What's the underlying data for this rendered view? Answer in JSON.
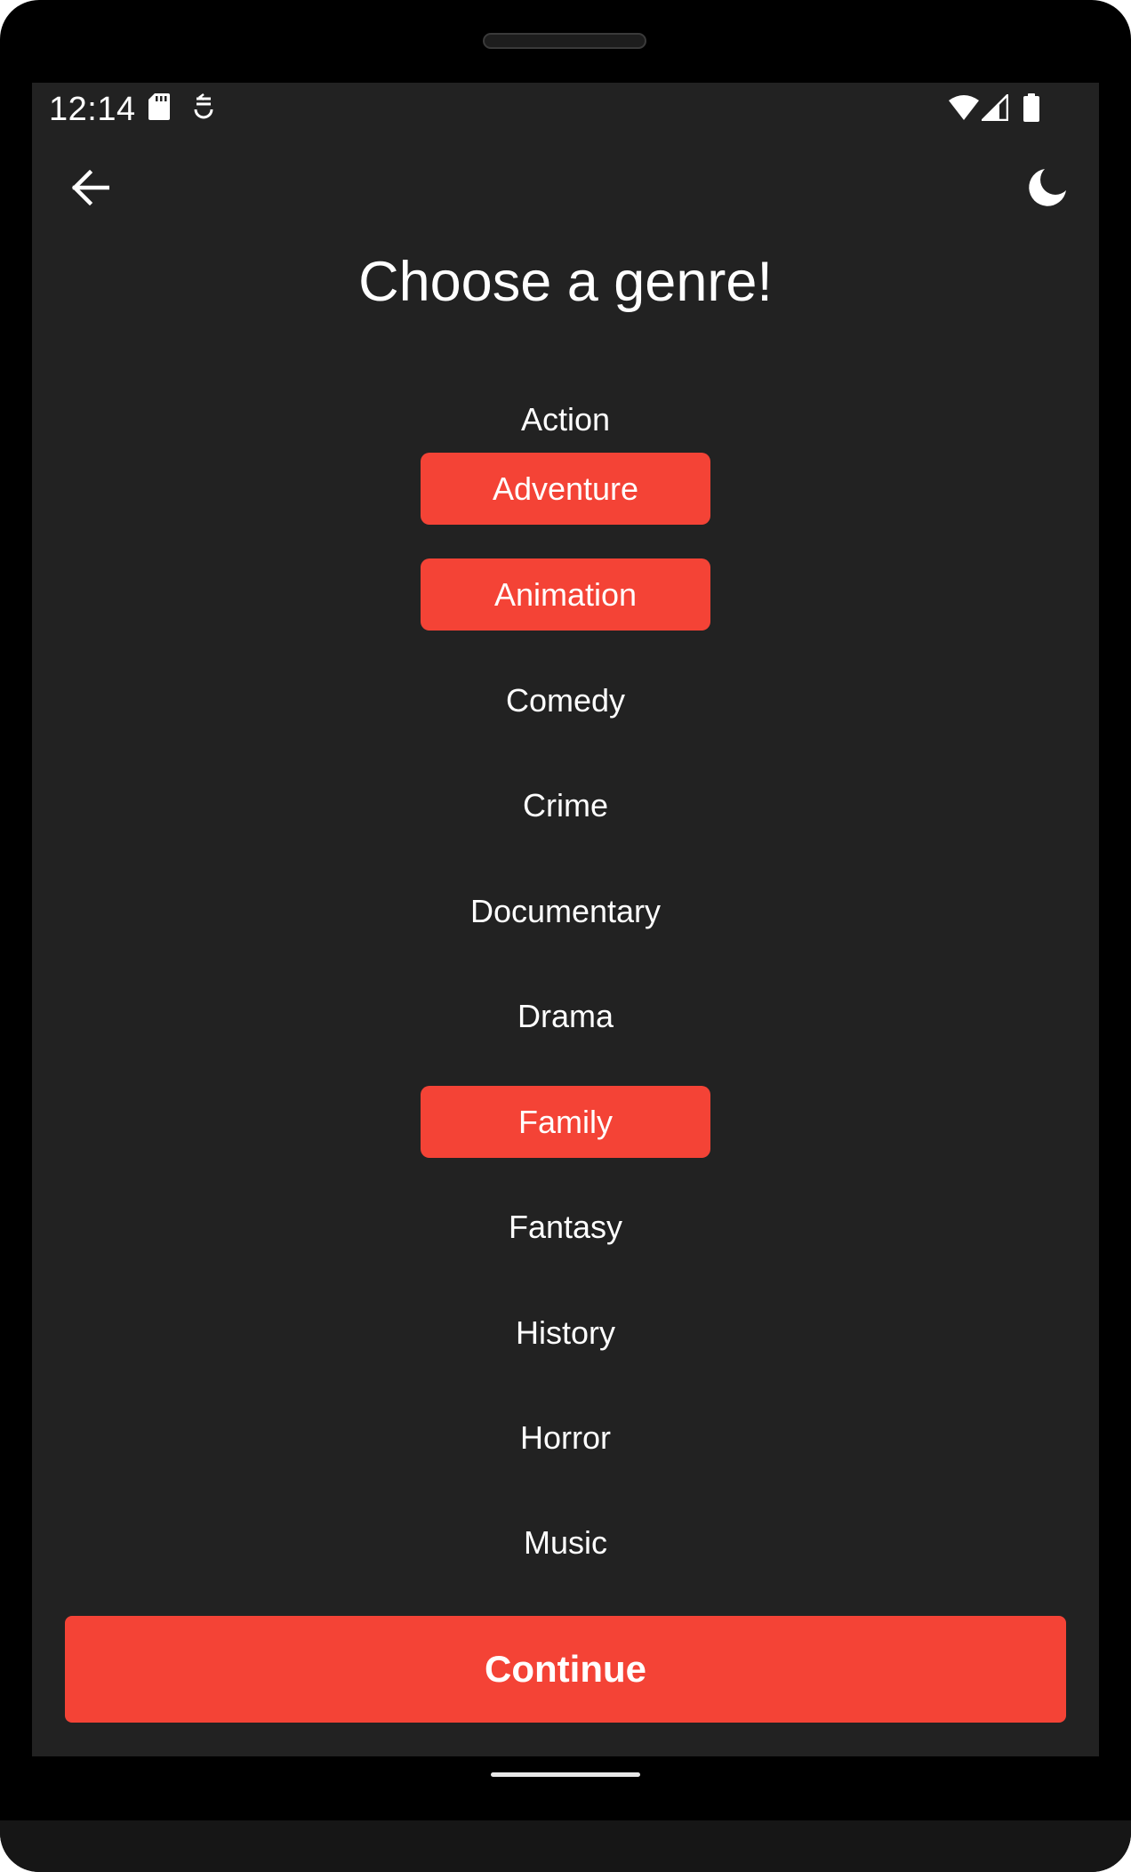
{
  "status_bar": {
    "time": "12:14",
    "icons": [
      "sd-card-icon",
      "sync-icon",
      "wifi-icon",
      "signal-icon",
      "battery-icon"
    ]
  },
  "toolbar": {
    "back_icon": "arrow-back-icon",
    "theme_icon": "moon-icon"
  },
  "title": "Choose a genre!",
  "genres": [
    {
      "label": "Action",
      "selected": false
    },
    {
      "label": "Adventure",
      "selected": true
    },
    {
      "label": "Animation",
      "selected": true
    },
    {
      "label": "Comedy",
      "selected": false
    },
    {
      "label": "Crime",
      "selected": false
    },
    {
      "label": "Documentary",
      "selected": false
    },
    {
      "label": "Drama",
      "selected": false
    },
    {
      "label": "Family",
      "selected": true
    },
    {
      "label": "Fantasy",
      "selected": false
    },
    {
      "label": "History",
      "selected": false
    },
    {
      "label": "Horror",
      "selected": false
    },
    {
      "label": "Music",
      "selected": false
    }
  ],
  "continue_label": "Continue",
  "colors": {
    "accent": "#f44336",
    "background": "#222222",
    "text": "#ffffff"
  }
}
